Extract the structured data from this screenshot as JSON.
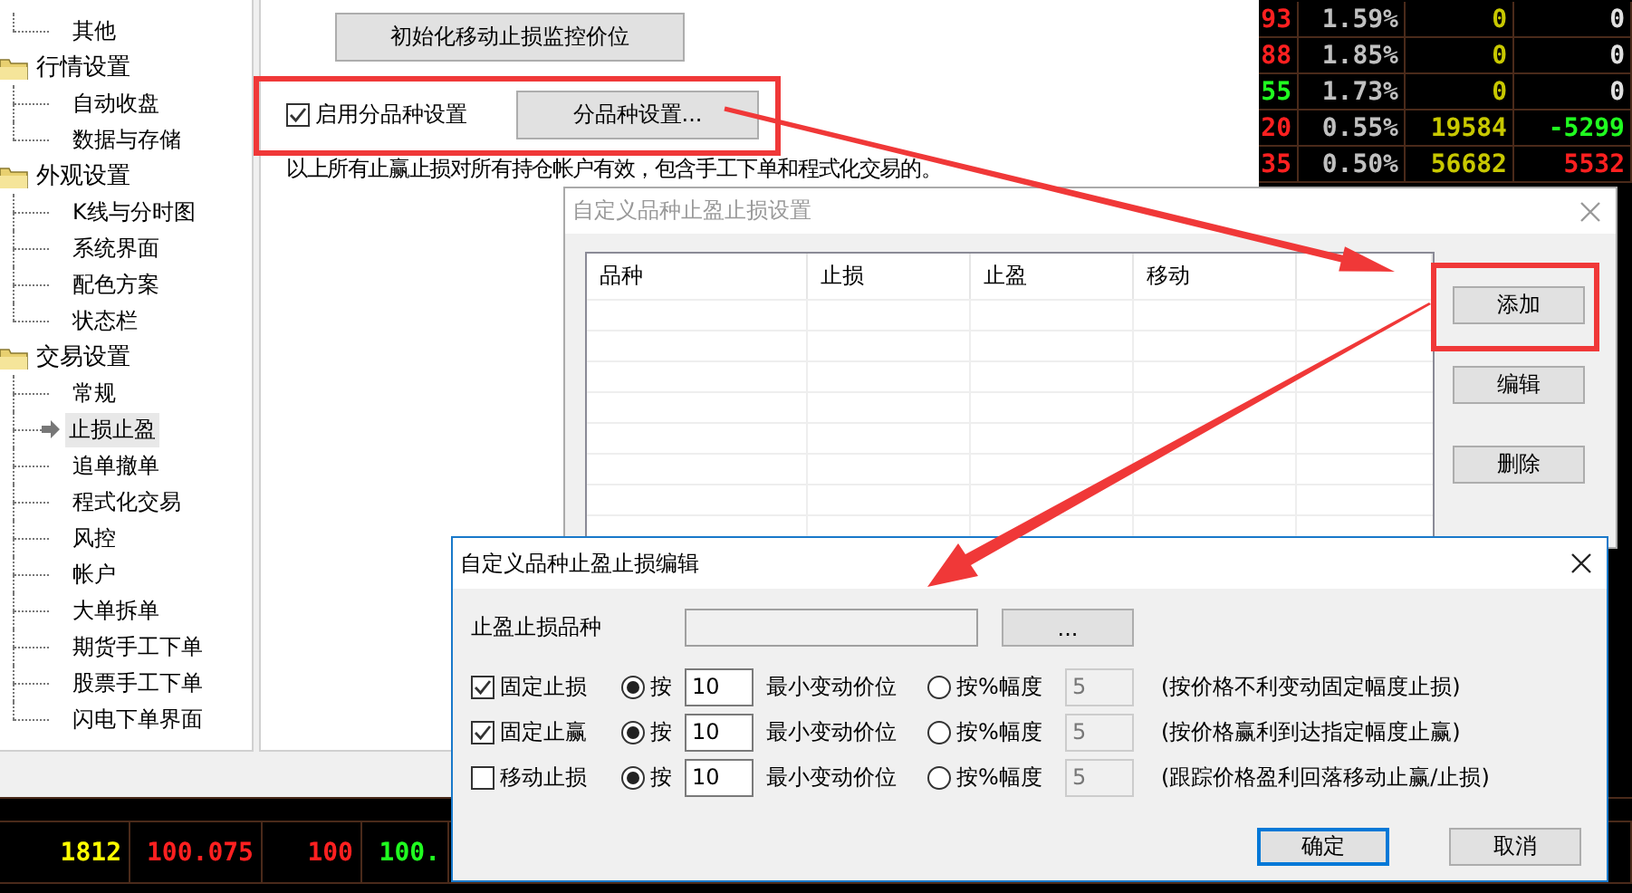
{
  "settings_tree": [
    {
      "children": [
        {
          "label": "其他",
          "selected": false
        }
      ]
    },
    {
      "label": "行情设置",
      "children": [
        {
          "label": "自动收盘",
          "selected": false
        },
        {
          "label": "数据与存储",
          "selected": false
        }
      ]
    },
    {
      "label": "外观设置",
      "children": [
        {
          "label": "K线与分时图",
          "selected": false
        },
        {
          "label": "系统界面",
          "selected": false
        },
        {
          "label": "配色方案",
          "selected": false
        },
        {
          "label": "状态栏",
          "selected": false
        }
      ]
    },
    {
      "label": "交易设置",
      "children": [
        {
          "label": "常规",
          "selected": false
        },
        {
          "label": "止损止盈",
          "selected": true
        },
        {
          "label": "追单撤单",
          "selected": false
        },
        {
          "label": "程式化交易",
          "selected": false
        },
        {
          "label": "风控",
          "selected": false
        },
        {
          "label": "帐户",
          "selected": false
        },
        {
          "label": "大单拆单",
          "selected": false
        },
        {
          "label": "期货手工下单",
          "selected": false
        },
        {
          "label": "股票手工下单",
          "selected": false
        },
        {
          "label": "闪电下单界面",
          "selected": false
        }
      ]
    }
  ],
  "settings_panel": {
    "reset_button": "初始化移动止损监控价位",
    "per_symbol": {
      "label": "启用分品种设置",
      "checked": true
    },
    "per_symbol_button": "分品种设置...",
    "note": "以上所有止赢止损对所有持仓帐户有效，包含手工下单和程式化交易的。"
  },
  "market_rows": [
    [
      {
        "text": "93",
        "rising": true
      },
      {
        "text": "1.59%"
      },
      {
        "text": "0"
      },
      {
        "text": "0"
      }
    ],
    [
      {
        "text": "88",
        "rising": true
      },
      {
        "text": "1.85%"
      },
      {
        "text": "0"
      },
      {
        "text": "0"
      }
    ],
    [
      {
        "text": "55",
        "rising": false
      },
      {
        "text": "1.73%"
      },
      {
        "text": "0"
      },
      {
        "text": "0"
      }
    ],
    [
      {
        "text": "20",
        "rising": true
      },
      {
        "text": "0.55%"
      },
      {
        "text": "19584"
      },
      {
        "text": "-5299",
        "rising": false
      }
    ],
    [
      {
        "text": "35",
        "rising": true
      },
      {
        "text": "0.50%"
      },
      {
        "text": "56682"
      },
      {
        "text": "5532",
        "rising": true
      }
    ]
  ],
  "market_bottom_row": [
    {
      "text": "1812"
    },
    {
      "text": "100.075",
      "rising": true
    },
    {
      "text": "100",
      "rising": true
    },
    {
      "text": "100.",
      "rising": false
    }
  ],
  "list_dialog": {
    "title": "自定义品种止盈止损设置",
    "columns": [
      "品种",
      "止损",
      "止盈",
      "移动"
    ],
    "buttons": [
      "添加",
      "编辑",
      "删除"
    ]
  },
  "edit_dialog": {
    "title": "自定义品种止盈止损编辑",
    "symbol_label": "止盈止损品种",
    "browse_button": "...",
    "rules": [
      {
        "label": "固定止损",
        "checked": true,
        "options": [
          {
            "label": "按",
            "selected": true,
            "value": "10",
            "unit": "最小变动价位"
          },
          {
            "label": "按%幅度",
            "selected": false,
            "value": "5"
          }
        ],
        "hint": "(按价格不利变动固定幅度止损)"
      },
      {
        "label": "固定止赢",
        "checked": true,
        "options": [
          {
            "label": "按",
            "selected": true,
            "value": "10",
            "unit": "最小变动价位"
          },
          {
            "label": "按%幅度",
            "selected": false,
            "value": "5"
          }
        ],
        "hint": "(按价格赢利到达指定幅度止赢)"
      },
      {
        "label": "移动止损",
        "checked": false,
        "options": [
          {
            "label": "按",
            "selected": true,
            "value": "10",
            "unit": "最小变动价位"
          },
          {
            "label": "按%幅度",
            "selected": false,
            "value": "5"
          }
        ],
        "hint": "(跟踪价格盈利回落移动止赢/止损)"
      }
    ],
    "buttons": [
      {
        "label": "确定",
        "default": true
      },
      {
        "label": "取消",
        "default": false
      }
    ]
  }
}
